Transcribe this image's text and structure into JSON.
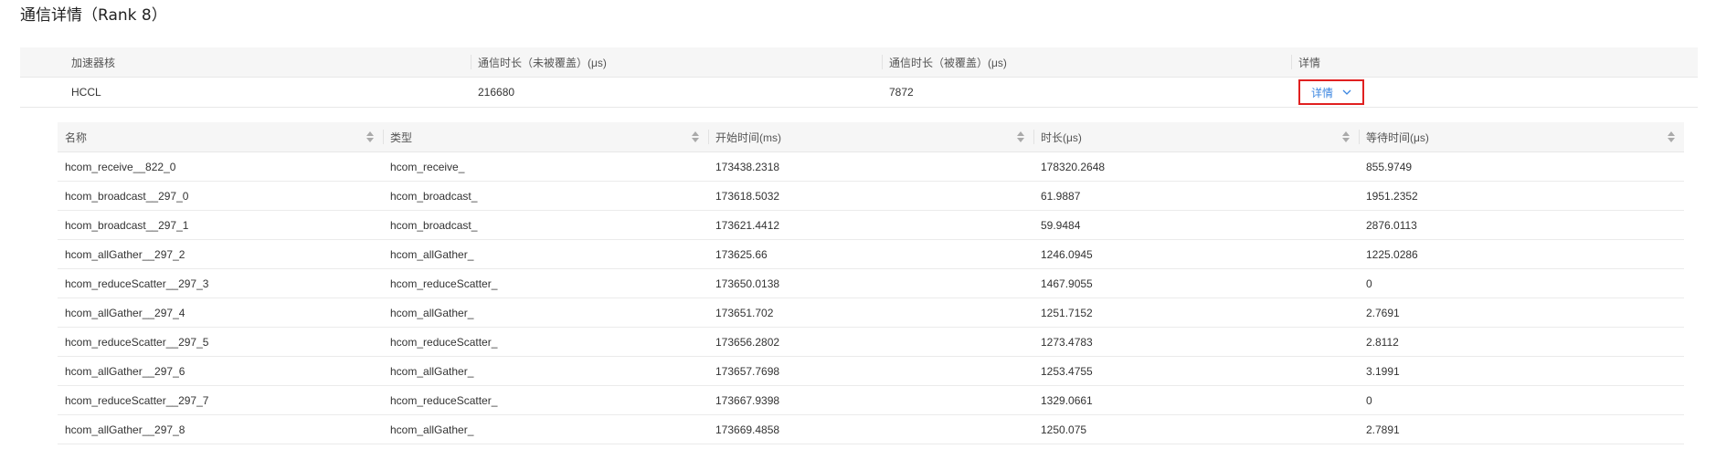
{
  "page_title": "通信详情（Rank 8）",
  "outer_table": {
    "columns": [
      "加速器核",
      "通信时长（未被覆盖）(μs)",
      "通信时长（被覆盖）(μs)",
      "详情"
    ],
    "row": {
      "core": "HCCL",
      "uncovered": "216680",
      "covered": "7872",
      "detail_label": "详情"
    }
  },
  "inner_table": {
    "columns": [
      "名称",
      "类型",
      "开始时间(ms)",
      "时长(μs)",
      "等待时间(μs)"
    ],
    "rows": [
      [
        "hcom_receive__822_0",
        "hcom_receive_",
        "173438.2318",
        "178320.2648",
        "855.9749"
      ],
      [
        "hcom_broadcast__297_0",
        "hcom_broadcast_",
        "173618.5032",
        "61.9887",
        "1951.2352"
      ],
      [
        "hcom_broadcast__297_1",
        "hcom_broadcast_",
        "173621.4412",
        "59.9484",
        "2876.0113"
      ],
      [
        "hcom_allGather__297_2",
        "hcom_allGather_",
        "173625.66",
        "1246.0945",
        "1225.0286"
      ],
      [
        "hcom_reduceScatter__297_3",
        "hcom_reduceScatter_",
        "173650.0138",
        "1467.9055",
        "0"
      ],
      [
        "hcom_allGather__297_4",
        "hcom_allGather_",
        "173651.702",
        "1251.7152",
        "2.7691"
      ],
      [
        "hcom_reduceScatter__297_5",
        "hcom_reduceScatter_",
        "173656.2802",
        "1273.4783",
        "2.8112"
      ],
      [
        "hcom_allGather__297_6",
        "hcom_allGather_",
        "173657.7698",
        "1253.4755",
        "3.1991"
      ],
      [
        "hcom_reduceScatter__297_7",
        "hcom_reduceScatter_",
        "173667.9398",
        "1329.0661",
        "0"
      ],
      [
        "hcom_allGather__297_8",
        "hcom_allGather_",
        "173669.4858",
        "1250.075",
        "2.7891"
      ]
    ]
  },
  "icons": {
    "expand": "chevron-down-icon",
    "sort": "sort-icon"
  },
  "colors": {
    "link": "#3b86e0",
    "highlight_border": "#e02020",
    "header_bg": "#f6f6f6"
  }
}
